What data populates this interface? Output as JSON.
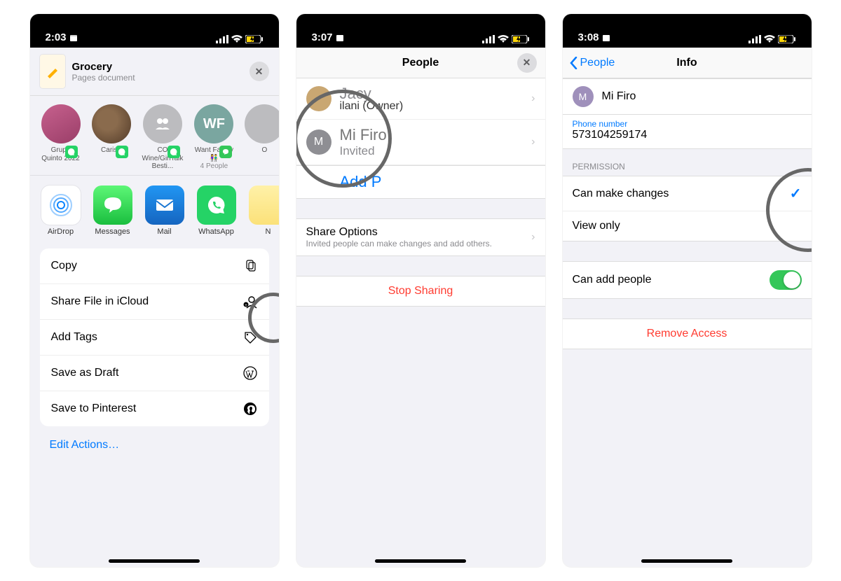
{
  "screen1": {
    "time": "2:03",
    "doc": {
      "title": "Grocery",
      "subtitle": "Pages document"
    },
    "contacts": [
      {
        "label": "Grupo Quinto 2022"
      },
      {
        "label": "Carisa"
      },
      {
        "label": "CO Wine/GirlTalk Besti..."
      },
      {
        "label": "Want Family 👫",
        "sublabel": "4 People",
        "initials": "WF"
      },
      {
        "label": "O"
      }
    ],
    "apps": [
      {
        "label": "AirDrop"
      },
      {
        "label": "Messages"
      },
      {
        "label": "Mail"
      },
      {
        "label": "WhatsApp"
      },
      {
        "label": "N"
      }
    ],
    "actions": {
      "copy": "Copy",
      "share_icloud": "Share File in iCloud",
      "add_tags": "Add Tags",
      "save_draft": "Save as Draft",
      "save_pinterest": "Save to Pinterest"
    },
    "edit_actions": "Edit Actions…"
  },
  "screen2": {
    "time": "3:07",
    "nav_title": "People",
    "people": [
      {
        "name": "Jacy",
        "role": "ilani (Owner)"
      },
      {
        "initial": "M",
        "name": "Mi Firo",
        "status": "Invited"
      }
    ],
    "add_people": "Add P",
    "share_options": {
      "title": "Share Options",
      "sub": "Invited people can make changes and add others."
    },
    "stop_sharing": "Stop Sharing"
  },
  "screen3": {
    "time": "3:08",
    "back": "People",
    "nav_title": "Info",
    "person": {
      "initial": "M",
      "name": "Mi Firo"
    },
    "phone": {
      "label": "Phone number",
      "value": "573104259174"
    },
    "permission_header": "PERMISSION",
    "perm_changes": "Can make changes",
    "perm_viewonly": "View only",
    "can_add": "Can add people",
    "remove_access": "Remove Access"
  }
}
